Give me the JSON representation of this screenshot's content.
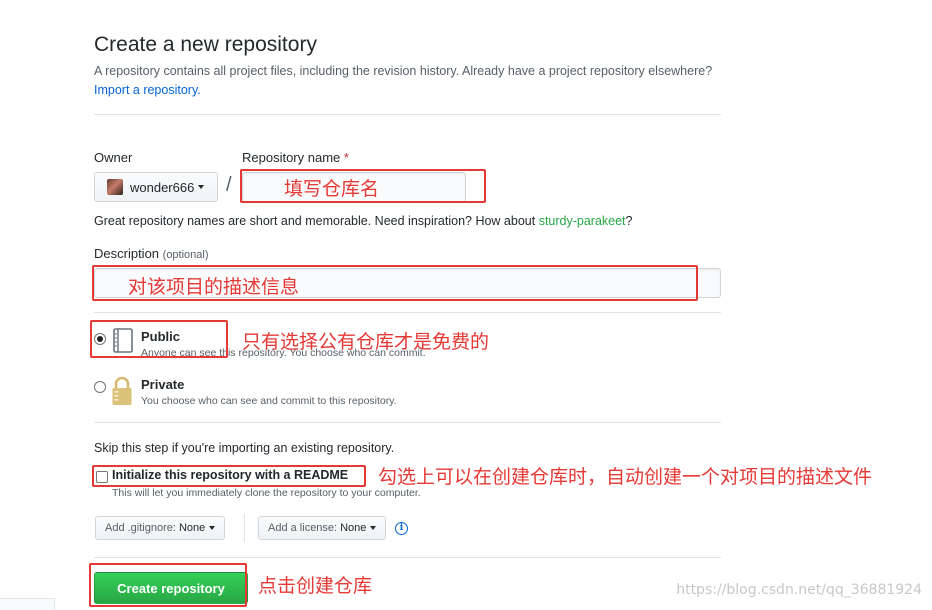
{
  "header": {
    "title": "Create a new repository",
    "subtitle_text": "A repository contains all project files, including the revision history. Already have a project repository elsewhere?",
    "import_link": "Import a repository."
  },
  "owner": {
    "label": "Owner",
    "value": "wonder666"
  },
  "repo_name": {
    "label": "Repository name",
    "required_mark": "*",
    "separator": "/",
    "value": ""
  },
  "name_hint": {
    "text": "Great repository names are short and memorable. Need inspiration? How about",
    "suggestion": "sturdy-parakeet",
    "suffix": "?"
  },
  "description": {
    "label": "Description",
    "optional": "(optional)",
    "value": ""
  },
  "visibility": {
    "public": {
      "title": "Public",
      "note": "Anyone can see this repository. You choose who can commit.",
      "checked": true
    },
    "private": {
      "title": "Private",
      "note": "You choose who can see and commit to this repository.",
      "checked": false
    }
  },
  "init": {
    "skip_note": "Skip this step if you're importing an existing repository.",
    "readme_label": "Initialize this repository with a README",
    "readme_note": "This will let you immediately clone the repository to your computer.",
    "readme_checked": false
  },
  "add_ons": {
    "gitignore_label": "Add .gitignore:",
    "gitignore_value": "None",
    "license_label": "Add a license:",
    "license_value": "None",
    "info_icon": "info-icon"
  },
  "submit": {
    "label": "Create repository"
  },
  "annotations": {
    "repo_name": "填写仓库名",
    "description": "对该项目的描述信息",
    "public": "只有选择公有仓库才是免费的",
    "readme": "勾选上可以在创建仓库时，自动创建一个对项目的描述文件",
    "submit": "点击创建仓库"
  },
  "watermark": "https://blog.csdn.net/qq_36881924",
  "colors": {
    "primary_green": "#28a745",
    "link_blue": "#0366d6",
    "annotation_red": "#e53935"
  }
}
